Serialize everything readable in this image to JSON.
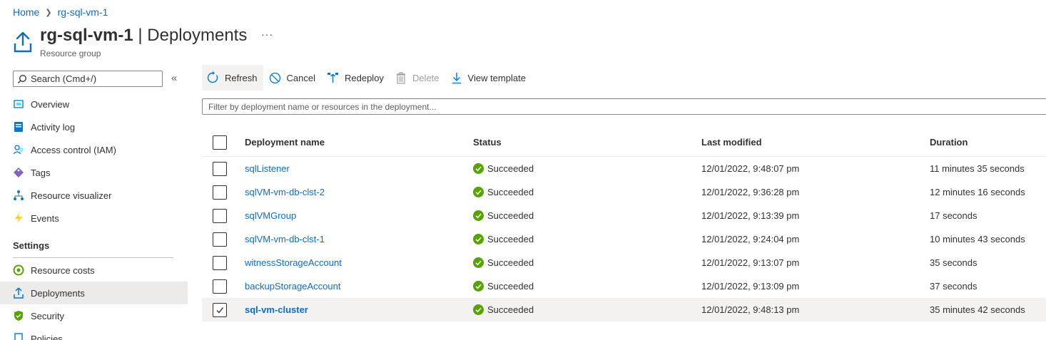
{
  "breadcrumb": {
    "home": "Home",
    "current": "rg-sql-vm-1"
  },
  "page": {
    "resource_name": "rg-sql-vm-1",
    "separator": " | ",
    "blade": "Deployments",
    "subtitle": "Resource group",
    "more": "···"
  },
  "sidebar": {
    "search_placeholder": "Search (Cmd+/)",
    "collapse": "«",
    "items": [
      {
        "label": "Overview",
        "icon": "overview-icon"
      },
      {
        "label": "Activity log",
        "icon": "activity-log-icon"
      },
      {
        "label": "Access control (IAM)",
        "icon": "iam-icon"
      },
      {
        "label": "Tags",
        "icon": "tag-icon"
      },
      {
        "label": "Resource visualizer",
        "icon": "visualizer-icon"
      },
      {
        "label": "Events",
        "icon": "events-icon"
      }
    ],
    "section_settings": "Settings",
    "settings_items": [
      {
        "label": "Resource costs",
        "icon": "cost-icon"
      },
      {
        "label": "Deployments",
        "icon": "deployments-icon",
        "active": true
      },
      {
        "label": "Security",
        "icon": "security-icon"
      },
      {
        "label": "Policies",
        "icon": "policies-icon"
      }
    ]
  },
  "toolbar": {
    "refresh": "Refresh",
    "cancel": "Cancel",
    "redeploy": "Redeploy",
    "delete": "Delete",
    "view_template": "View template"
  },
  "filter": {
    "placeholder": "Filter by deployment name or resources in the deployment..."
  },
  "table": {
    "headers": {
      "name": "Deployment name",
      "status": "Status",
      "modified": "Last modified",
      "duration": "Duration"
    },
    "rows": [
      {
        "name": "sqlListener",
        "status": "Succeeded",
        "modified": "12/01/2022, 9:48:07 pm",
        "duration": "11 minutes 35 seconds"
      },
      {
        "name": "sqlVM-vm-db-clst-2",
        "status": "Succeeded",
        "modified": "12/01/2022, 9:36:28 pm",
        "duration": "12 minutes 16 seconds"
      },
      {
        "name": "sqlVMGroup",
        "status": "Succeeded",
        "modified": "12/01/2022, 9:13:39 pm",
        "duration": "17 seconds"
      },
      {
        "name": "sqlVM-vm-db-clst-1",
        "status": "Succeeded",
        "modified": "12/01/2022, 9:24:04 pm",
        "duration": "10 minutes 43 seconds"
      },
      {
        "name": "witnessStorageAccount",
        "status": "Succeeded",
        "modified": "12/01/2022, 9:13:07 pm",
        "duration": "35 seconds"
      },
      {
        "name": "backupStorageAccount",
        "status": "Succeeded",
        "modified": "12/01/2022, 9:13:09 pm",
        "duration": "37 seconds"
      },
      {
        "name": "sql-vm-cluster",
        "status": "Succeeded",
        "modified": "12/01/2022, 9:48:13 pm",
        "duration": "35 minutes 42 seconds",
        "selected": true
      }
    ]
  },
  "colors": {
    "accent": "#0f6cbd",
    "success": "#57a300",
    "selected_bg": "#f3f2f1"
  }
}
